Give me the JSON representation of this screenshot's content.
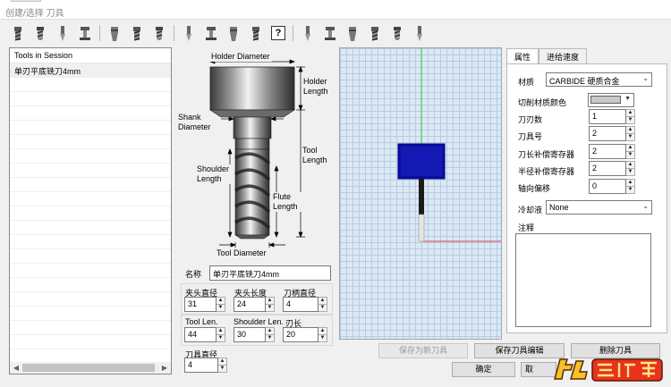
{
  "window": {
    "title": "创建/选择 刀具"
  },
  "toolbar": {
    "icons": [
      "flat-endmill-icon",
      "ball-endmill-icon",
      "bull-endmill-icon",
      "drill-icon",
      "tapered-endmill-icon",
      "tapered-ball-icon",
      "t-slot-icon",
      "engrave-icon",
      "chamfer-icon",
      "dovetail-icon",
      "lollipop-icon",
      "help-icon",
      "face-mill-icon",
      "center-drill-icon",
      "reamer-icon",
      "tap-icon",
      "bore-icon",
      "spot-drill-icon"
    ],
    "help_glyph": "?"
  },
  "session": {
    "header": "Tools in Session",
    "tools": [
      "单刃平底铣刀4mm"
    ]
  },
  "diagram": {
    "holder_diameter": "Holder Diameter",
    "holder_length": "Holder Length",
    "shank_diameter": "Shank Diameter",
    "tool_length": "Tool Length",
    "shoulder_length": "Shoulder Length",
    "flute_length": "Flute Length",
    "tool_diameter": "Tool Diameter"
  },
  "form": {
    "name_label": "名称",
    "name_value": "单刃平底铣刀4mm",
    "holder_diameter_label": "夹头直径",
    "holder_diameter_value": "31",
    "holder_length_label": "夹头长度",
    "holder_length_value": "24",
    "shank_diameter_label": "刀柄直径",
    "shank_diameter_value": "4",
    "tool_len_label": "Tool Len.",
    "tool_len_value": "44",
    "shoulder_len_label": "Shoulder Len.",
    "shoulder_len_value": "30",
    "flute_len_label": "刃长",
    "flute_len_value": "20",
    "tool_diameter_label": "刀具直径",
    "tool_diameter_value": "4"
  },
  "tabs": {
    "properties": "属性",
    "feeds": "进给速度"
  },
  "properties": {
    "material_label": "材质",
    "material_value": "CARBIDE 硬质合金",
    "cut_color_label": "切削材质颜色",
    "flutes_label": "刀刃数",
    "flutes_value": "1",
    "tool_number_label": "刀具号",
    "tool_number_value": "2",
    "length_offset_label": "刀长补偿寄存器",
    "length_offset_value": "2",
    "radius_offset_label": "半径补偿寄存器",
    "radius_offset_value": "2",
    "axial_offset_label": "轴向偏移",
    "axial_offset_value": "0",
    "coolant_label": "冷却液",
    "coolant_value": "None",
    "notes_label": "注释"
  },
  "buttons": {
    "save_as_new": "保存为新刀具",
    "save_edits": "保存刀具编辑",
    "delete": "删除刀具",
    "ok": "确定",
    "cancel": "取"
  },
  "colors": {
    "holder_blue": "#0a0fa0",
    "viewport_bg": "#dce8f5",
    "axis_green": "#3fcf3f",
    "axis_red": "#e04040"
  }
}
